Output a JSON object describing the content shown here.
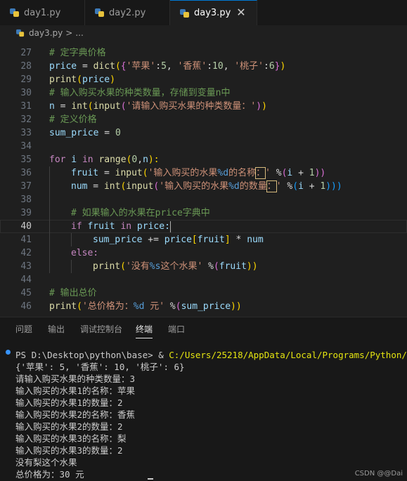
{
  "tabs": [
    {
      "label": "day1.py",
      "active": false
    },
    {
      "label": "day2.py",
      "active": false
    },
    {
      "label": "day3.py",
      "active": true
    }
  ],
  "tab_close": "✕",
  "breadcrumb": {
    "file": "day3.py",
    "sep": ">",
    "rest": "..."
  },
  "editor": {
    "line_numbers": [
      "27",
      "28",
      "29",
      "30",
      "31",
      "32",
      "33",
      "34",
      "35",
      "36",
      "37",
      "38",
      "39",
      "40",
      "41",
      "42",
      "43",
      "44",
      "45",
      "46"
    ],
    "current_line": "40"
  },
  "code": {
    "c27": "# 定字典价格",
    "l28_a": "price",
    "l28_b": " = ",
    "l28_c": "dict",
    "l28_d": "(",
    "l28_e": "{",
    "l28_f": "'苹果'",
    "l28_g": ":",
    "l28_h": "5",
    "l28_i": ", ",
    "l28_j": "'香蕉'",
    "l28_k": ":",
    "l28_l": "10",
    "l28_m": ", ",
    "l28_n": "'桃子'",
    "l28_o": ":",
    "l28_p": "6",
    "l28_q": "}",
    "l28_r": ")",
    "l29_a": "print",
    "l29_b": "(",
    "l29_c": "price",
    "l29_d": ")",
    "c30": "# 输入购买水果的种类数量，存储到变量n中",
    "l31_a": "n",
    "l31_b": " = ",
    "l31_c": "int",
    "l31_d": "(",
    "l31_e": "input",
    "l31_f": "(",
    "l31_g": "'请输入购买水果的种类数量：'",
    "l31_h": ")",
    "l31_i": ")",
    "c32": "# 定义价格",
    "l33_a": "sum_price",
    "l33_b": " = ",
    "l33_c": "0",
    "l35_a": "for",
    "l35_b": " i ",
    "l35_c": "in",
    "l35_d": " ",
    "l35_e": "range",
    "l35_f": "(",
    "l35_g": "0",
    "l35_h": ",",
    "l35_i": "n",
    "l35_j": "):",
    "l36_a": "fruit",
    "l36_b": " = ",
    "l36_c": "input",
    "l36_d": "(",
    "l36_e": "'输入购买的水果",
    "l36_f": "%d",
    "l36_g": "的名称",
    "l36_h": "：",
    "l36_i": "'",
    "l36_j": " %",
    "l36_k": "(",
    "l36_l": "i",
    "l36_m": " + ",
    "l36_n": "1",
    "l36_o": "))",
    "l37_a": "num",
    "l37_b": " = ",
    "l37_c": "int",
    "l37_d": "(",
    "l37_e": "input",
    "l37_f": "(",
    "l37_g": "'输入购买的水果",
    "l37_h": "%d",
    "l37_i": "的数量",
    "l37_j": "：",
    "l37_k": "'",
    "l37_l": " %",
    "l37_m": "(",
    "l37_n": "i",
    "l37_o": " + ",
    "l37_p": "1",
    "l37_q": ")))",
    "c39": "# 如果输入的水果在price字典中",
    "l40_a": "if",
    "l40_b": " fruit ",
    "l40_c": "in",
    "l40_d": " price:",
    "l41_a": "sum_price",
    "l41_b": " += ",
    "l41_c": "price",
    "l41_d": "[",
    "l41_e": "fruit",
    "l41_f": "]",
    "l41_g": " * ",
    "l41_h": "num",
    "l42_a": "else:",
    "l43_a": "print",
    "l43_b": "(",
    "l43_c": "'没有",
    "l43_d": "%s",
    "l43_e": "这个水果'",
    "l43_f": " %",
    "l43_g": "(",
    "l43_h": "fruit",
    "l43_i": "))",
    "c45": "# 输出总价",
    "l46_a": "print",
    "l46_b": "(",
    "l46_c": "'总价格为：",
    "l46_d": "%d",
    "l46_e": " 元'",
    "l46_f": " %",
    "l46_g": "(",
    "l46_h": "sum_price",
    "l46_i": "))"
  },
  "panel": {
    "tabs": [
      "问题",
      "输出",
      "调试控制台",
      "终端",
      "端口"
    ],
    "active": "终端"
  },
  "terminal": {
    "prompt": "PS D:\\Desktop\\python\\base> & ",
    "command": "C:/Users/25218/AppData/Local/Programs/Python/Python",
    "lines": [
      "{'苹果': 5, '香蕉': 10, '桃子': 6}",
      "请输入购买水果的种类数量：3",
      "输入购买的水果1的名称：苹果",
      "输入购买的水果1的数量：2",
      "输入购买的水果2的名称：香蕉",
      "输入购买的水果2的数量：2",
      "输入购买的水果3的名称：梨",
      "输入购买的水果3的数量：2",
      "没有梨这个水果",
      "总价格为：30 元"
    ]
  },
  "watermark": "CSDN @@Dai"
}
